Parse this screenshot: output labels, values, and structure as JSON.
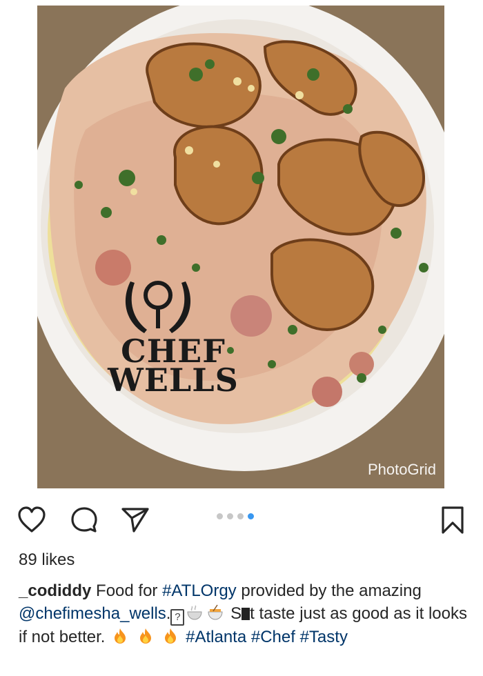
{
  "photo": {
    "watermark_line1": "CHEF",
    "watermark_line2": "WELLS",
    "photogrid_label": "PhotoGrid"
  },
  "actions": {
    "icons": [
      "heart-icon",
      "comment-icon",
      "share-icon",
      "bookmark-icon"
    ],
    "carousel_total": 4,
    "carousel_active_index": 3
  },
  "post": {
    "likes": "89 likes",
    "username": "_codiddy",
    "text_1": " Food for ",
    "tag_atl": "#ATLOrgy",
    "text_2": " provided by the amazing ",
    "mention": "@chefimesha_wells",
    "text_3": ".",
    "missing_glyph": "?",
    "text_4": " S",
    "text_5": "t taste just as good as it looks if not better. ",
    "tag_atlanta": "#Atlanta",
    "tag_chef": "#Chef",
    "tag_tasty": "#Tasty"
  },
  "colors": {
    "link": "#003569",
    "active_dot": "#3897f0",
    "inactive_dot": "#c7c7c7"
  }
}
